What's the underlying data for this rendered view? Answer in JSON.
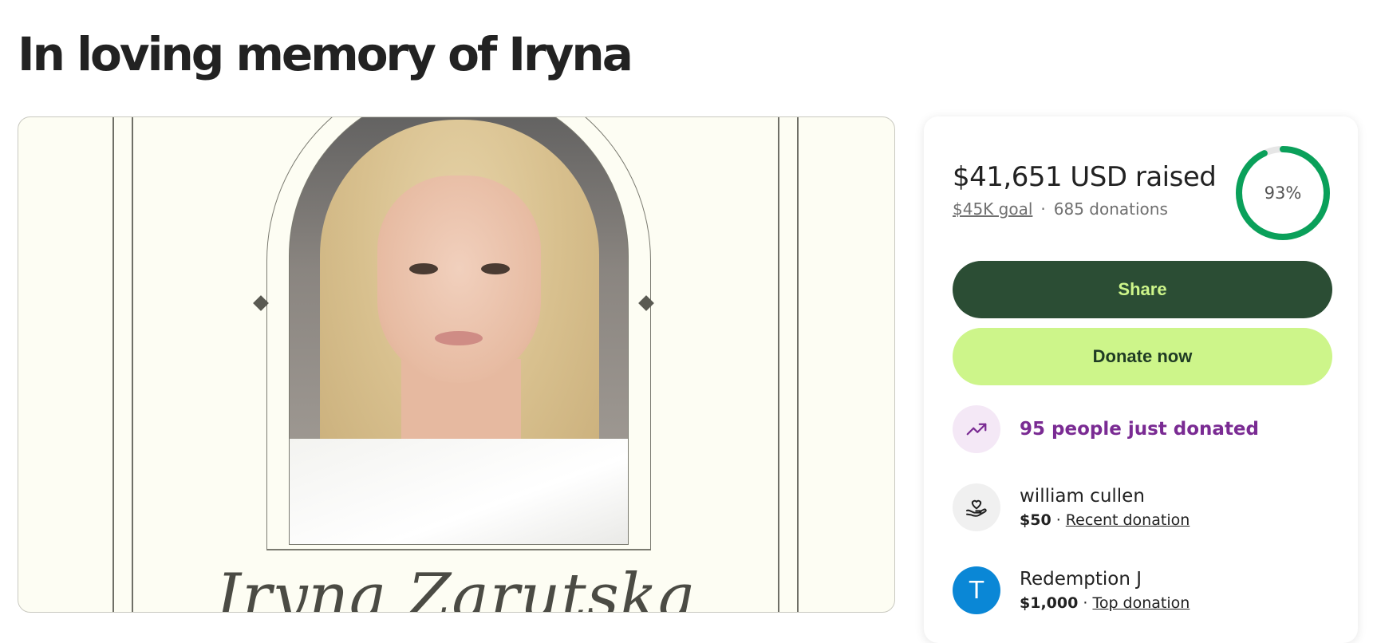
{
  "page": {
    "title": "In loving memory of Iryna"
  },
  "hero": {
    "name_text": "Iryna Zarutska"
  },
  "donation": {
    "raised": "$41,651 USD raised",
    "goal": "$45K goal",
    "separator": "·",
    "donations_count": "685 donations",
    "progress_percent": 93,
    "progress_label": "93%",
    "progress_color": "#0aa05a",
    "share_label": "Share",
    "donate_label": "Donate now",
    "trend_text": "95 people just donated",
    "donors": [
      {
        "name": "william cullen",
        "amount": "$50",
        "sep": " · ",
        "tag": "Recent donation",
        "avatar_letter": ""
      },
      {
        "name": "Redemption J",
        "amount": "$1,000",
        "sep": " · ",
        "tag": "Top donation",
        "avatar_letter": "T"
      }
    ]
  },
  "colors": {
    "share_bg": "#2b4d34",
    "share_text": "#cdf58a",
    "donate_bg": "#cdf58a",
    "trend_text": "#7a2b93",
    "avatar_blue": "#0a87d6"
  },
  "icons": {
    "trend": "trending-up-icon",
    "heart": "hand-heart-icon"
  }
}
